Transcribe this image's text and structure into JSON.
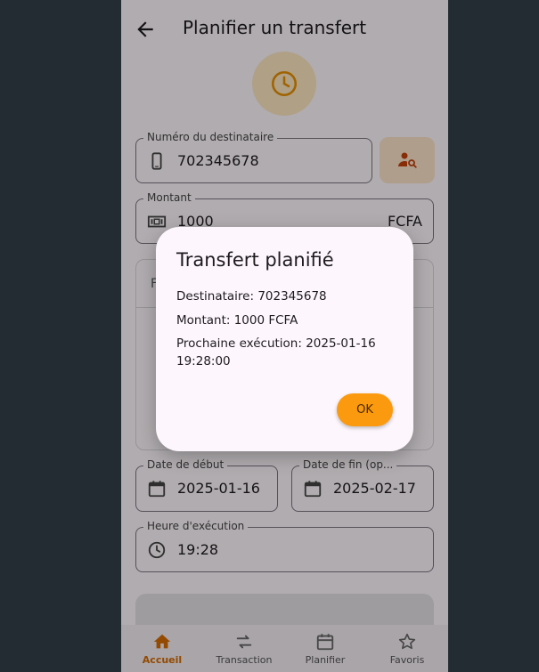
{
  "appbar": {
    "title": "Planifier un transfert"
  },
  "fields": {
    "recipient": {
      "label": "Numéro du destinataire",
      "value": "702345678"
    },
    "amount": {
      "label": "Montant",
      "value": "1000",
      "suffix": "FCFA"
    },
    "start_date": {
      "label": "Date de début",
      "value": "2025-01-16"
    },
    "end_date": {
      "label": "Date de fin (op...",
      "value": "2025-02-17"
    },
    "time": {
      "label": "Heure d'exécution",
      "value": "19:28"
    }
  },
  "card": {
    "partial_text": "F"
  },
  "dialog": {
    "title": "Transfert planifié",
    "recipient_line": "Destinataire: 702345678",
    "amount_line": "Montant: 1000 FCFA",
    "next_run_line": "Prochaine exécution: 2025-01-16 19:28:00",
    "ok_label": "OK"
  },
  "bottom_nav": {
    "items": [
      {
        "label": "Accueil",
        "icon": "home-icon",
        "active": true
      },
      {
        "label": "Transaction",
        "icon": "swap-icon",
        "active": false
      },
      {
        "label": "Planifier",
        "icon": "calendar-icon",
        "active": false
      },
      {
        "label": "Favoris",
        "icon": "star-icon",
        "active": false
      }
    ]
  },
  "colors": {
    "accent": "#fb9a0e",
    "active_nav": "#d46a00",
    "background": "#242c33"
  }
}
